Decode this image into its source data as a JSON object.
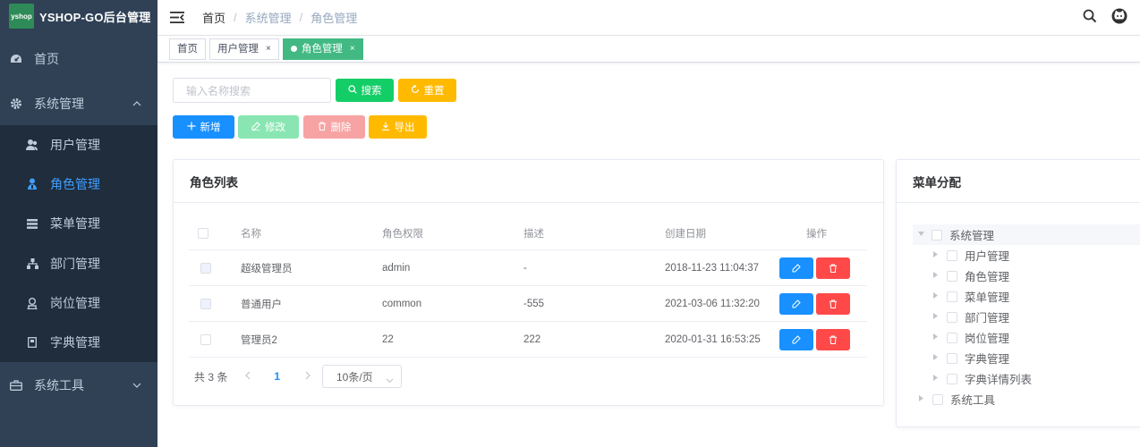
{
  "app": {
    "logo_text": "yshop",
    "title": "YSHOP-GO后台管理"
  },
  "sidebar": {
    "home": "首页",
    "system": "系统管理",
    "sub_items": [
      "用户管理",
      "角色管理",
      "菜单管理",
      "部门管理",
      "岗位管理",
      "字典管理"
    ],
    "active_sub": "角色管理",
    "tools": "系统工具"
  },
  "breadcrumb": [
    "首页",
    "系统管理",
    "角色管理"
  ],
  "breadcrumb_sep": "/",
  "tags": [
    {
      "label": "首页",
      "closable": false,
      "active": false
    },
    {
      "label": "用户管理",
      "closable": true,
      "active": false
    },
    {
      "label": "角色管理",
      "closable": true,
      "active": true
    }
  ],
  "tag_close": "×",
  "toolbar": {
    "search_placeholder": "输入名称搜索",
    "search_label": "搜索",
    "reset_label": "重置",
    "add_label": "新增",
    "edit_label": "修改",
    "delete_label": "删除",
    "export_label": "导出"
  },
  "role_card": {
    "title": "角色列表",
    "columns": [
      "名称",
      "角色权限",
      "描述",
      "创建日期",
      "操作"
    ],
    "rows": [
      {
        "name": "超级管理员",
        "permission": "admin",
        "desc": "-",
        "created": "2018-11-23 11:04:37",
        "checkbox_disabled": true
      },
      {
        "name": "普通用户",
        "permission": "common",
        "desc": "-555",
        "created": "2021-03-06 11:32:20",
        "checkbox_disabled": true
      },
      {
        "name": "管理员2",
        "permission": "22",
        "desc": "222",
        "created": "2020-01-31 16:53:25",
        "checkbox_disabled": false
      }
    ]
  },
  "pagination": {
    "total_text": "共 3 条",
    "current_page": "1",
    "page_size": "10条/页"
  },
  "menu_card": {
    "title": "菜单分配",
    "tree": [
      {
        "label": "系统管理",
        "expanded": true
      },
      {
        "label": "用户管理",
        "level": 2
      },
      {
        "label": "角色管理",
        "level": 2
      },
      {
        "label": "菜单管理",
        "level": 2
      },
      {
        "label": "部门管理",
        "level": 2
      },
      {
        "label": "岗位管理",
        "level": 2
      },
      {
        "label": "字典管理",
        "level": 2
      },
      {
        "label": "字典详情列表",
        "level": 2
      },
      {
        "label": "系统工具",
        "expanded": false
      }
    ]
  },
  "colors": {
    "sidebar_bg": "#304156",
    "submenu_bg": "#1f2d3d",
    "active_menu": "#409eff",
    "tag_active": "#42b983",
    "primary": "#1890ff",
    "success": "#13ce66",
    "warning": "#ffba00",
    "danger": "#ff4949"
  }
}
